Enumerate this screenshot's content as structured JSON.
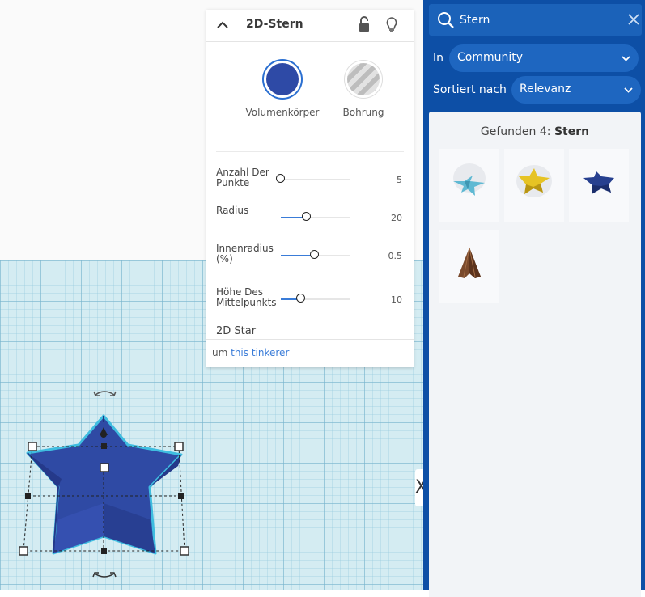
{
  "inspector": {
    "title": "2D-Stern",
    "materials": [
      {
        "label": "Volumenkörper",
        "color": "#2e4aa6"
      },
      {
        "label": "Bohrung"
      }
    ],
    "properties": [
      {
        "name": "Anzahl Der Punkte",
        "value": "5",
        "fraction": 0.0
      },
      {
        "name": "Radius",
        "value": "20",
        "fraction": 0.37
      },
      {
        "name": "Innenradius (%)",
        "value": "0.5",
        "fraction": 0.49
      },
      {
        "name": "Höhe Des Mittelpunkts",
        "value": "10",
        "fraction": 0.29
      }
    ],
    "shape_name": "2D Star",
    "author_prefix": "um",
    "author_link": "this tinkerer"
  },
  "sidebar": {
    "search_value": "Stern",
    "in_label": "In",
    "in_value": "Community",
    "sort_label": "Sortiert nach",
    "sort_value": "Relevanz",
    "results_prefix": "Gefunden 4:",
    "results_query": "Stern",
    "results": [
      {
        "name": "light-blue-star-shape",
        "color": "#5fb9d3"
      },
      {
        "name": "yellow-star-shape",
        "color": "#e6c324"
      },
      {
        "name": "navy-star-shape",
        "color": "#27408f"
      },
      {
        "name": "brown-cone-star-shape",
        "color": "#7a4a2c"
      }
    ]
  },
  "workplane": {
    "edge_label": "X",
    "star_color": "#2e4aa6",
    "accent_color": "#3fbde0"
  }
}
